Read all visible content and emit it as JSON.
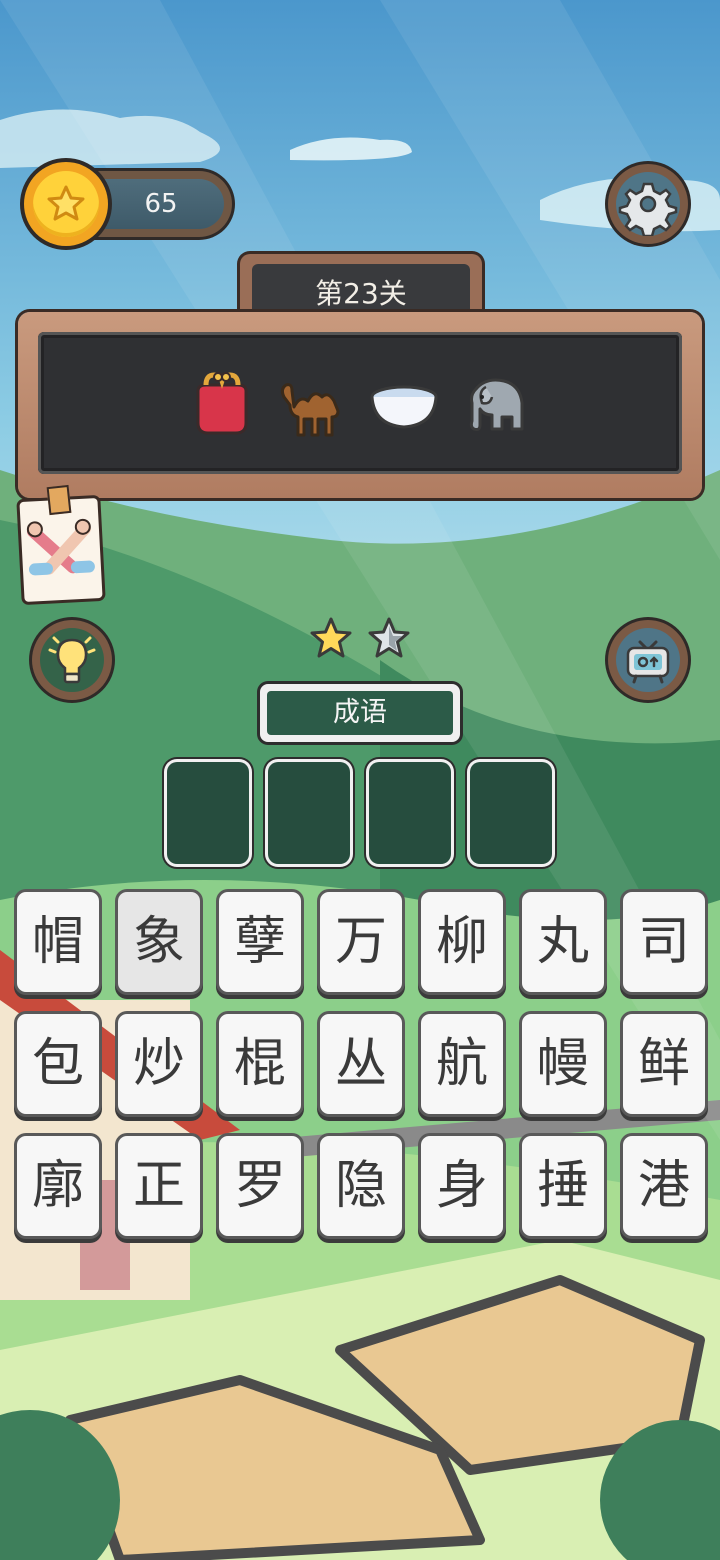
{
  "coins": {
    "value": "65",
    "icon": "star-coin-icon"
  },
  "settings": {
    "icon": "gear-icon"
  },
  "level": {
    "title": "第23关"
  },
  "clues": [
    {
      "name": "coin-purse-icon"
    },
    {
      "name": "camel-icon"
    },
    {
      "name": "bowl-icon"
    },
    {
      "name": "elephant-icon"
    }
  ],
  "hint_note": {
    "icon": "crossed-arms-icon"
  },
  "hint_button": {
    "icon": "lightbulb-icon"
  },
  "video_button": {
    "icon": "tv-video-icon"
  },
  "stars": {
    "filled": 1,
    "total": 2
  },
  "category": {
    "label": "成语"
  },
  "answer_slots": 4,
  "tiles": [
    [
      "帽",
      "象",
      "孽",
      "万",
      "柳",
      "丸",
      "司"
    ],
    [
      "包",
      "炒",
      "棍",
      "丛",
      "航",
      "幔",
      "鲜"
    ],
    [
      "廓",
      "正",
      "罗",
      "隐",
      "身",
      "捶",
      "港"
    ]
  ],
  "colors": {
    "slot": "#264d3e",
    "category": "#2c5b48",
    "board": "#2f3033",
    "coin": "#ffd23a"
  }
}
